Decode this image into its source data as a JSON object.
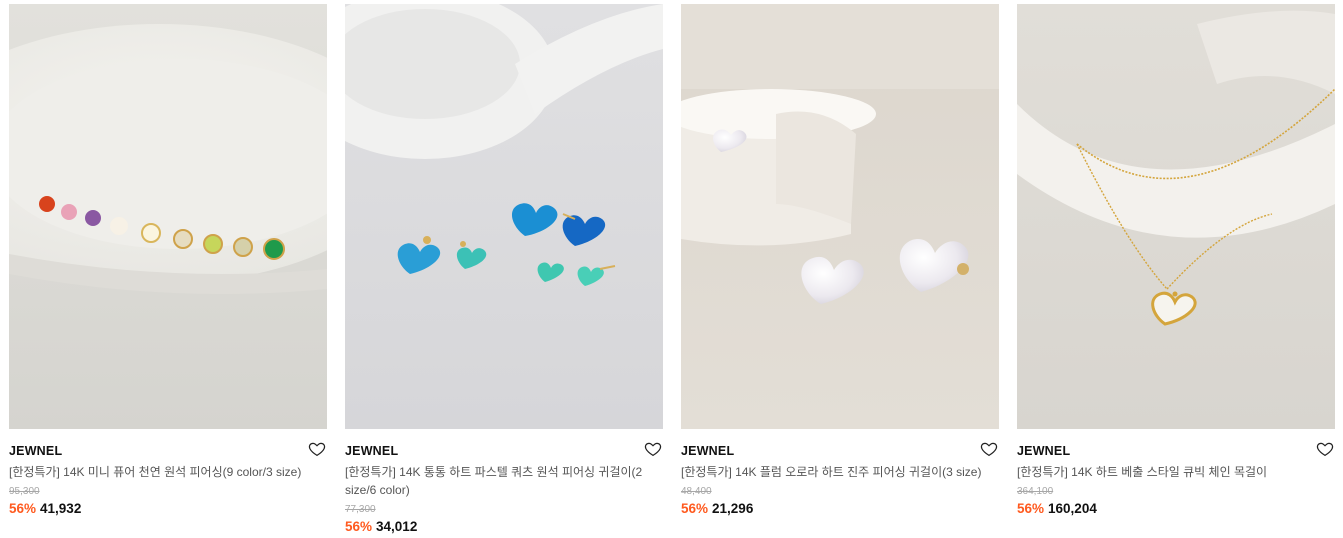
{
  "products": [
    {
      "brand": "JEWNEL",
      "name": "[한정특가] 14K 미니 퓨어 천연 원석 피어싱(9 color/3 size)",
      "original_price": "95,300",
      "discount": "56%",
      "price": "41,932",
      "image_desc": "colorful-stud-earrings-on-plate"
    },
    {
      "brand": "JEWNEL",
      "name": "[한정특가] 14K 통통 하트 파스텔 쿼츠 원석 피어싱 귀걸이(2 size/6 color)",
      "original_price": "77,300",
      "discount": "56%",
      "price": "34,012",
      "image_desc": "blue-heart-earrings"
    },
    {
      "brand": "JEWNEL",
      "name": "[한정특가] 14K 플럼 오로라 하트 진주 피어싱 귀걸이(3 size)",
      "original_price": "48,400",
      "discount": "56%",
      "price": "21,296",
      "image_desc": "pearl-heart-earrings-with-bowl"
    },
    {
      "brand": "JEWNEL",
      "name": "[한정특가] 14K 하트 베출 스타일 큐빅 체인 목걸이",
      "original_price": "364,100",
      "discount": "56%",
      "price": "160,204",
      "image_desc": "gold-heart-necklace"
    }
  ],
  "icons": {
    "wishlist": "heart-outline-icon"
  },
  "colors": {
    "discount": "#ff5a1f",
    "brand": "#111111"
  }
}
